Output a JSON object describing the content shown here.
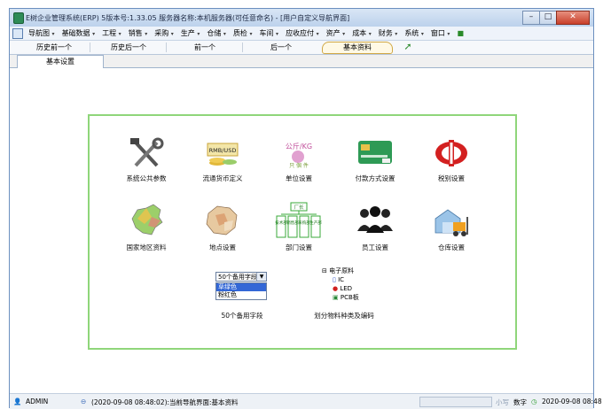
{
  "window": {
    "title": "E树企业管理系统(ERP) 5版本号:1.33.05  服务器名称:本机服务器(可任意命名) - [用户自定义导航界面]"
  },
  "menus": [
    "导航图",
    "基础数据",
    "工程",
    "销售",
    "采购",
    "生产",
    "仓储",
    "质检",
    "车间",
    "应收应付",
    "资产",
    "成本",
    "财务",
    "系统",
    "窗口"
  ],
  "navbar": {
    "buttons": [
      "历史前一个",
      "历史后一个",
      "前一个",
      "后一个"
    ],
    "active": "基本资料"
  },
  "tab": {
    "label": "基本设置"
  },
  "grid": {
    "row1": [
      "系统公共参数",
      "流通货币定义",
      "单位设置",
      "付款方式设置",
      "税别设置"
    ],
    "row2": [
      "国家地区资料",
      "地点设置",
      "部门设置",
      "员工设置",
      "仓库设置"
    ],
    "row3": [
      "50个备用字段",
      "划分物料种类及编码"
    ]
  },
  "icons": {
    "currency_text": "RMB/USD",
    "unit_text": "公斤/KG",
    "unit_sub": "只 個 件",
    "org_top": "厂长",
    "org_depts": [
      "技术部",
      "销售部",
      "采购部",
      "生产部"
    ]
  },
  "fields_widget": {
    "combo_value": "50个备用字段",
    "options": [
      "草绿色",
      "粉红色"
    ]
  },
  "tree_widget": {
    "root": "电子原料",
    "children": [
      "IC",
      "LED",
      "PCB板"
    ]
  },
  "status": {
    "user": "ADMIN",
    "message": "(2020-09-08 08:48:02):当前导航界面:基本资料",
    "mode1": "小写",
    "mode2": "数字",
    "datetime": "2020-09-08 08:48"
  }
}
